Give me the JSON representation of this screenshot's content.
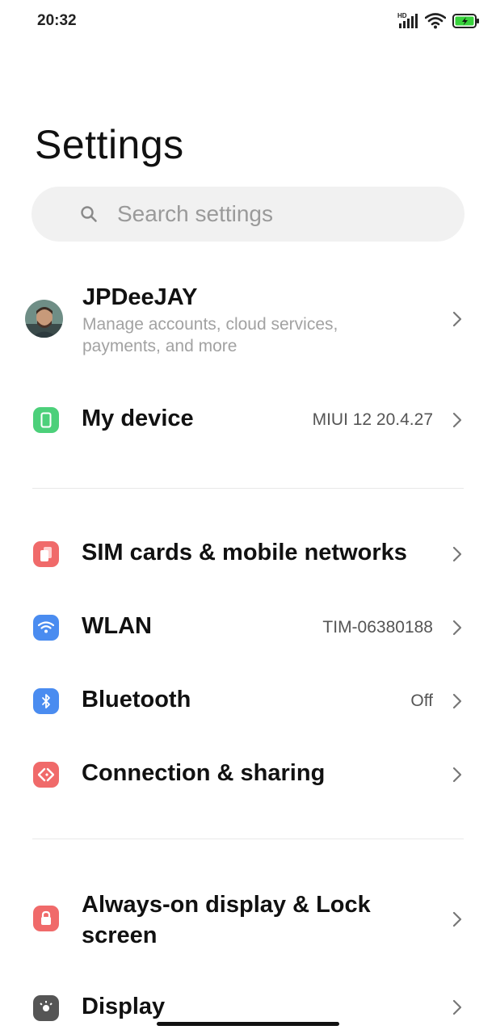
{
  "status_bar": {
    "time": "20:32",
    "network_label": "HD",
    "icons": [
      "signal-icon",
      "wifi-icon",
      "battery-charging-icon"
    ]
  },
  "title": "Settings",
  "search": {
    "placeholder": "Search settings",
    "value": ""
  },
  "account": {
    "name": "JPDeeJAY",
    "subtitle": "Manage accounts, cloud services, payments, and more"
  },
  "my_device": {
    "label": "My device",
    "value": "MIUI 12 20.4.27",
    "icon": "phone-icon",
    "color": "#4cd07a"
  },
  "network_items": [
    {
      "label": "SIM cards & mobile networks",
      "value": "",
      "icon": "sim-card-icon",
      "color": "#f06a6a"
    },
    {
      "label": "WLAN",
      "value": "TIM-06380188",
      "icon": "wifi-icon",
      "color": "#4a8cf0"
    },
    {
      "label": "Bluetooth",
      "value": "Off",
      "icon": "bluetooth-icon",
      "color": "#4a8cf0"
    },
    {
      "label": "Connection & sharing",
      "value": "",
      "icon": "share-icon",
      "color": "#f06a6a"
    }
  ],
  "display_items": [
    {
      "label": "Always-on display & Lock screen",
      "icon": "lock-icon",
      "color": "#f06a6a"
    },
    {
      "label": "Display",
      "icon": "brightness-icon",
      "color": "#555555"
    }
  ]
}
